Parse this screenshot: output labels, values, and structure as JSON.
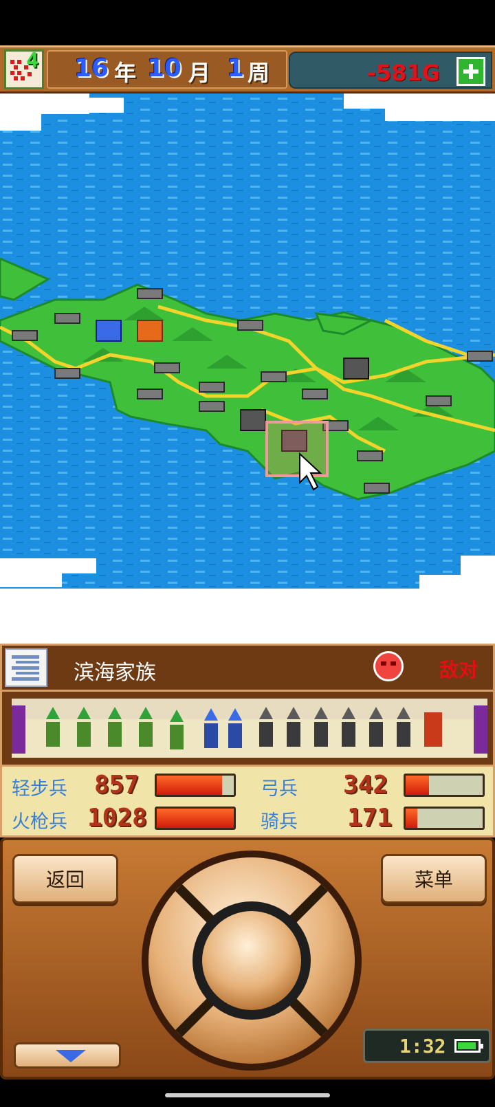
{
  "header": {
    "clan_count": "4",
    "year": "16",
    "year_unit": "年",
    "month": "10",
    "month_unit": "月",
    "week": "1",
    "week_unit": "周",
    "gold": "-581G"
  },
  "clan": {
    "name": "滨海家族",
    "relation": "敌对"
  },
  "troops": [
    {
      "label": "轻步兵",
      "value": "857",
      "fill": 0.85
    },
    {
      "label": "弓兵",
      "value": "342",
      "fill": 0.3
    },
    {
      "label": "火枪兵",
      "value": "1028",
      "fill": 1.0
    },
    {
      "label": "骑兵",
      "value": "171",
      "fill": 0.15
    }
  ],
  "controls": {
    "back_label": "返回",
    "menu_label": "菜单"
  },
  "status": {
    "clock": "1:32"
  },
  "colors": {
    "sea": "#1c8fe0",
    "land": "#3fbf3a",
    "road": "#f3d42a",
    "gold_negative": "#e1131a"
  }
}
